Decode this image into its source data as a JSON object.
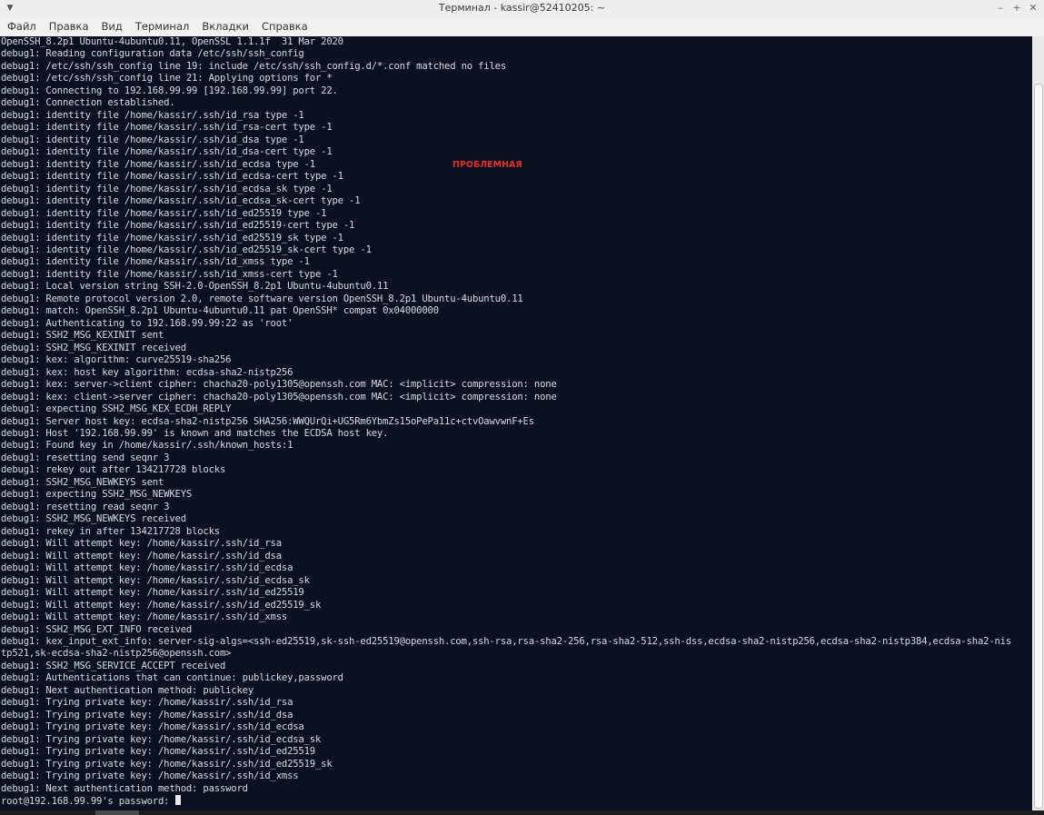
{
  "window": {
    "title": "Терминал - kassir@52410205: ~",
    "menu_icon": "menu-icon",
    "controls": [
      "–",
      "+",
      "✕"
    ]
  },
  "menubar": {
    "items": [
      "Файл",
      "Правка",
      "Вид",
      "Терминал",
      "Вкладки",
      "Справка"
    ]
  },
  "annotation": {
    "text": "ПРОБЛЕМНАЯ",
    "color": "#e0302a"
  },
  "terminal": {
    "prompt": "root@192.168.99.99's password: ",
    "lines": [
      "OpenSSH_8.2p1 Ubuntu-4ubuntu0.11, OpenSSL 1.1.1f  31 Mar 2020",
      "debug1: Reading configuration data /etc/ssh/ssh_config",
      "debug1: /etc/ssh/ssh_config line 19: include /etc/ssh/ssh_config.d/*.conf matched no files",
      "debug1: /etc/ssh/ssh_config line 21: Applying options for *",
      "debug1: Connecting to 192.168.99.99 [192.168.99.99] port 22.",
      "debug1: Connection established.",
      "debug1: identity file /home/kassir/.ssh/id_rsa type -1",
      "debug1: identity file /home/kassir/.ssh/id_rsa-cert type -1",
      "debug1: identity file /home/kassir/.ssh/id_dsa type -1",
      "debug1: identity file /home/kassir/.ssh/id_dsa-cert type -1",
      "debug1: identity file /home/kassir/.ssh/id_ecdsa type -1",
      "debug1: identity file /home/kassir/.ssh/id_ecdsa-cert type -1",
      "debug1: identity file /home/kassir/.ssh/id_ecdsa_sk type -1",
      "debug1: identity file /home/kassir/.ssh/id_ecdsa_sk-cert type -1",
      "debug1: identity file /home/kassir/.ssh/id_ed25519 type -1",
      "debug1: identity file /home/kassir/.ssh/id_ed25519-cert type -1",
      "debug1: identity file /home/kassir/.ssh/id_ed25519_sk type -1",
      "debug1: identity file /home/kassir/.ssh/id_ed25519_sk-cert type -1",
      "debug1: identity file /home/kassir/.ssh/id_xmss type -1",
      "debug1: identity file /home/kassir/.ssh/id_xmss-cert type -1",
      "debug1: Local version string SSH-2.0-OpenSSH_8.2p1 Ubuntu-4ubuntu0.11",
      "debug1: Remote protocol version 2.0, remote software version OpenSSH_8.2p1 Ubuntu-4ubuntu0.11",
      "debug1: match: OpenSSH_8.2p1 Ubuntu-4ubuntu0.11 pat OpenSSH* compat 0x04000000",
      "debug1: Authenticating to 192.168.99.99:22 as 'root'",
      "debug1: SSH2_MSG_KEXINIT sent",
      "debug1: SSH2_MSG_KEXINIT received",
      "debug1: kex: algorithm: curve25519-sha256",
      "debug1: kex: host key algorithm: ecdsa-sha2-nistp256",
      "debug1: kex: server->client cipher: chacha20-poly1305@openssh.com MAC: <implicit> compression: none",
      "debug1: kex: client->server cipher: chacha20-poly1305@openssh.com MAC: <implicit> compression: none",
      "debug1: expecting SSH2_MSG_KEX_ECDH_REPLY",
      "debug1: Server host key: ecdsa-sha2-nistp256 SHA256:WWQUrQi+UG5Rm6YbmZs15oPePa11c+ctvOawvwnF+Es",
      "debug1: Host '192.168.99.99' is known and matches the ECDSA host key.",
      "debug1: Found key in /home/kassir/.ssh/known_hosts:1",
      "debug1: resetting send seqnr 3",
      "debug1: rekey out after 134217728 blocks",
      "debug1: SSH2_MSG_NEWKEYS sent",
      "debug1: expecting SSH2_MSG_NEWKEYS",
      "debug1: resetting read seqnr 3",
      "debug1: SSH2_MSG_NEWKEYS received",
      "debug1: rekey in after 134217728 blocks",
      "debug1: Will attempt key: /home/kassir/.ssh/id_rsa",
      "debug1: Will attempt key: /home/kassir/.ssh/id_dsa",
      "debug1: Will attempt key: /home/kassir/.ssh/id_ecdsa",
      "debug1: Will attempt key: /home/kassir/.ssh/id_ecdsa_sk",
      "debug1: Will attempt key: /home/kassir/.ssh/id_ed25519",
      "debug1: Will attempt key: /home/kassir/.ssh/id_ed25519_sk",
      "debug1: Will attempt key: /home/kassir/.ssh/id_xmss",
      "debug1: SSH2_MSG_EXT_INFO received",
      "debug1: kex_input_ext_info: server-sig-algs=<ssh-ed25519,sk-ssh-ed25519@openssh.com,ssh-rsa,rsa-sha2-256,rsa-sha2-512,ssh-dss,ecdsa-sha2-nistp256,ecdsa-sha2-nistp384,ecdsa-sha2-nis",
      "tp521,sk-ecdsa-sha2-nistp256@openssh.com>",
      "debug1: SSH2_MSG_SERVICE_ACCEPT received",
      "debug1: Authentications that can continue: publickey,password",
      "debug1: Next authentication method: publickey",
      "debug1: Trying private key: /home/kassir/.ssh/id_rsa",
      "debug1: Trying private key: /home/kassir/.ssh/id_dsa",
      "debug1: Trying private key: /home/kassir/.ssh/id_ecdsa",
      "debug1: Trying private key: /home/kassir/.ssh/id_ecdsa_sk",
      "debug1: Trying private key: /home/kassir/.ssh/id_ed25519",
      "debug1: Trying private key: /home/kassir/.ssh/id_ed25519_sk",
      "debug1: Trying private key: /home/kassir/.ssh/id_xmss",
      "debug1: Next authentication method: password"
    ]
  }
}
